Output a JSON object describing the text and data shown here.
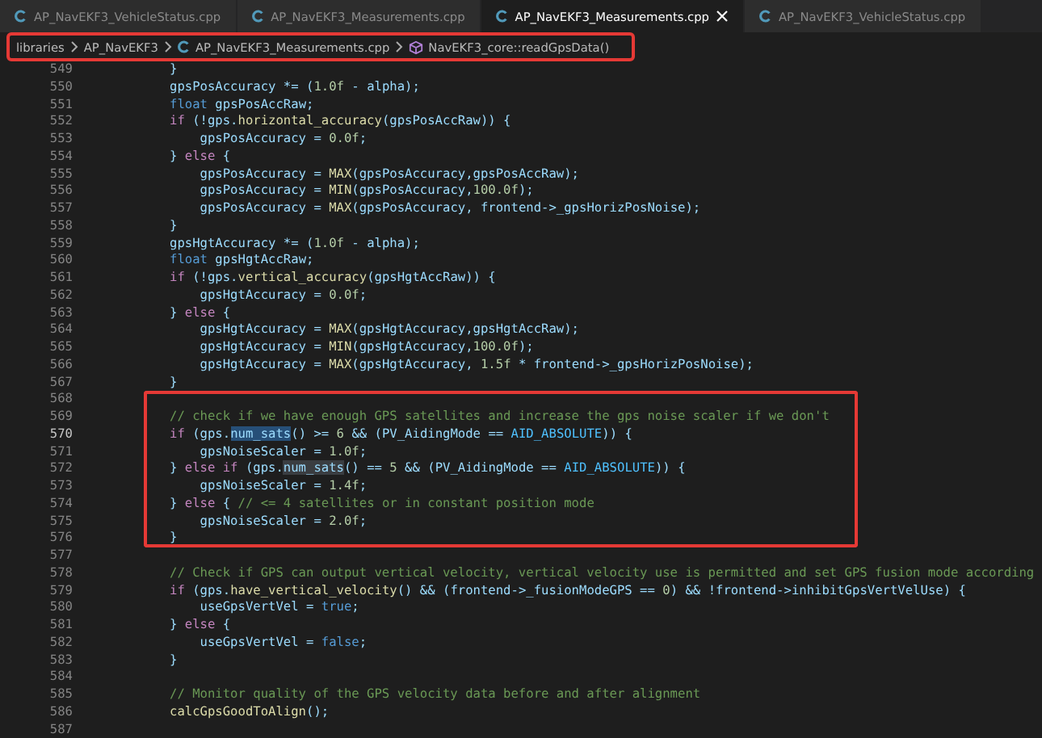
{
  "tabs": [
    {
      "label": "AP_NavEKF3_VehicleStatus.cpp",
      "selected": false
    },
    {
      "label": "AP_NavEKF3_Measurements.cpp",
      "selected": false
    },
    {
      "label": "AP_NavEKF3_Measurements.cpp",
      "selected": true
    },
    {
      "label": "AP_NavEKF3_VehicleStatus.cpp",
      "selected": false
    }
  ],
  "breadcrumb": {
    "outlined": true,
    "items": [
      {
        "kind": "folder",
        "label": "libraries"
      },
      {
        "kind": "folder",
        "label": "AP_NavEKF3"
      },
      {
        "kind": "file",
        "label": "AP_NavEKF3_Measurements.cpp"
      },
      {
        "kind": "symbol",
        "label": "NavEKF3_core::readGpsData()"
      }
    ]
  },
  "lines": [
    {
      "number": "549",
      "current": false,
      "outlined": false,
      "tokens": [
        {
          "kind": "var",
          "text": "}"
        }
      ]
    },
    {
      "number": "550",
      "current": false,
      "outlined": false,
      "tokens": [
        {
          "kind": "var",
          "text": "gpsPosAccuracy *= ("
        },
        {
          "kind": "num",
          "text": "1.0f"
        },
        {
          "kind": "var",
          "text": " - alpha);"
        }
      ]
    },
    {
      "number": "551",
      "current": false,
      "outlined": false,
      "tokens": [
        {
          "kind": "type",
          "text": "float"
        },
        {
          "kind": "var",
          "text": " gpsPosAccRaw;"
        }
      ]
    },
    {
      "number": "552",
      "current": false,
      "outlined": false,
      "tokens": [
        {
          "kind": "kw",
          "text": "if"
        },
        {
          "kind": "var",
          "text": " (!gps."
        },
        {
          "kind": "fn",
          "text": "horizontal_accuracy"
        },
        {
          "kind": "var",
          "text": "(gpsPosAccRaw)) {"
        }
      ]
    },
    {
      "number": "553",
      "current": false,
      "outlined": false,
      "tokens": [
        {
          "kind": "var",
          "text": "    gpsPosAccuracy = "
        },
        {
          "kind": "num",
          "text": "0.0f"
        },
        {
          "kind": "var",
          "text": ";"
        }
      ]
    },
    {
      "number": "554",
      "current": false,
      "outlined": false,
      "tokens": [
        {
          "kind": "var",
          "text": "} "
        },
        {
          "kind": "kw",
          "text": "else"
        },
        {
          "kind": "var",
          "text": " {"
        }
      ]
    },
    {
      "number": "555",
      "current": false,
      "outlined": false,
      "tokens": [
        {
          "kind": "var",
          "text": "    gpsPosAccuracy = "
        },
        {
          "kind": "fn",
          "text": "MAX"
        },
        {
          "kind": "var",
          "text": "(gpsPosAccuracy,gpsPosAccRaw);"
        }
      ]
    },
    {
      "number": "556",
      "current": false,
      "outlined": false,
      "tokens": [
        {
          "kind": "var",
          "text": "    gpsPosAccuracy = "
        },
        {
          "kind": "fn",
          "text": "MIN"
        },
        {
          "kind": "var",
          "text": "(gpsPosAccuracy,"
        },
        {
          "kind": "num",
          "text": "100.0f"
        },
        {
          "kind": "var",
          "text": ");"
        }
      ]
    },
    {
      "number": "557",
      "current": false,
      "outlined": false,
      "tokens": [
        {
          "kind": "var",
          "text": "    gpsPosAccuracy = "
        },
        {
          "kind": "fn",
          "text": "MAX"
        },
        {
          "kind": "var",
          "text": "(gpsPosAccuracy, frontend->_gpsHorizPosNoise);"
        }
      ]
    },
    {
      "number": "558",
      "current": false,
      "outlined": false,
      "tokens": [
        {
          "kind": "var",
          "text": "}"
        }
      ]
    },
    {
      "number": "559",
      "current": false,
      "outlined": false,
      "tokens": [
        {
          "kind": "var",
          "text": "gpsHgtAccuracy *= ("
        },
        {
          "kind": "num",
          "text": "1.0f"
        },
        {
          "kind": "var",
          "text": " - alpha);"
        }
      ]
    },
    {
      "number": "560",
      "current": false,
      "outlined": false,
      "tokens": [
        {
          "kind": "type",
          "text": "float"
        },
        {
          "kind": "var",
          "text": " gpsHgtAccRaw;"
        }
      ]
    },
    {
      "number": "561",
      "current": false,
      "outlined": false,
      "tokens": [
        {
          "kind": "kw",
          "text": "if"
        },
        {
          "kind": "var",
          "text": " (!gps."
        },
        {
          "kind": "fn",
          "text": "vertical_accuracy"
        },
        {
          "kind": "var",
          "text": "(gpsHgtAccRaw)) {"
        }
      ]
    },
    {
      "number": "562",
      "current": false,
      "outlined": false,
      "tokens": [
        {
          "kind": "var",
          "text": "    gpsHgtAccuracy = "
        },
        {
          "kind": "num",
          "text": "0.0f"
        },
        {
          "kind": "var",
          "text": ";"
        }
      ]
    },
    {
      "number": "563",
      "current": false,
      "outlined": false,
      "tokens": [
        {
          "kind": "var",
          "text": "} "
        },
        {
          "kind": "kw",
          "text": "else"
        },
        {
          "kind": "var",
          "text": " {"
        }
      ]
    },
    {
      "number": "564",
      "current": false,
      "outlined": false,
      "tokens": [
        {
          "kind": "var",
          "text": "    gpsHgtAccuracy = "
        },
        {
          "kind": "fn",
          "text": "MAX"
        },
        {
          "kind": "var",
          "text": "(gpsHgtAccuracy,gpsHgtAccRaw);"
        }
      ]
    },
    {
      "number": "565",
      "current": false,
      "outlined": false,
      "tokens": [
        {
          "kind": "var",
          "text": "    gpsHgtAccuracy = "
        },
        {
          "kind": "fn",
          "text": "MIN"
        },
        {
          "kind": "var",
          "text": "(gpsHgtAccuracy,"
        },
        {
          "kind": "num",
          "text": "100.0f"
        },
        {
          "kind": "var",
          "text": ");"
        }
      ]
    },
    {
      "number": "566",
      "current": false,
      "outlined": false,
      "tokens": [
        {
          "kind": "var",
          "text": "    gpsHgtAccuracy = "
        },
        {
          "kind": "fn",
          "text": "MAX"
        },
        {
          "kind": "var",
          "text": "(gpsHgtAccuracy, "
        },
        {
          "kind": "num",
          "text": "1.5f"
        },
        {
          "kind": "var",
          "text": " * frontend->_gpsHorizPosNoise);"
        }
      ]
    },
    {
      "number": "567",
      "current": false,
      "outlined": false,
      "tokens": [
        {
          "kind": "var",
          "text": "}"
        }
      ]
    },
    {
      "number": "568",
      "current": false,
      "outlined": true
    },
    {
      "number": "569",
      "current": false,
      "outlined": true,
      "tokens": [
        {
          "kind": "comment",
          "text": "// check if we have enough GPS satellites and increase the gps noise scaler if we don't"
        }
      ]
    },
    {
      "number": "570",
      "current": true,
      "outlined": true,
      "tokens": [
        {
          "kind": "kw",
          "text": "if"
        },
        {
          "kind": "var",
          "text": " (gps."
        },
        {
          "kind": "selection",
          "text": "num_sats"
        },
        {
          "kind": "var",
          "text": "() >= "
        },
        {
          "kind": "num",
          "text": "6"
        },
        {
          "kind": "var",
          "text": " && (PV_AidingMode == "
        },
        {
          "kind": "const",
          "text": "AID_ABSOLUTE"
        },
        {
          "kind": "var",
          "text": ")) {"
        }
      ]
    },
    {
      "number": "571",
      "current": false,
      "outlined": true,
      "tokens": [
        {
          "kind": "var",
          "text": "    gpsNoiseScaler = "
        },
        {
          "kind": "num",
          "text": "1.0f"
        },
        {
          "kind": "var",
          "text": ";"
        }
      ]
    },
    {
      "number": "572",
      "current": false,
      "outlined": true,
      "tokens": [
        {
          "kind": "var",
          "text": "} "
        },
        {
          "kind": "kw",
          "text": "else if"
        },
        {
          "kind": "var",
          "text": " (gps."
        },
        {
          "kind": "match",
          "text": "num_sats"
        },
        {
          "kind": "var",
          "text": "() == "
        },
        {
          "kind": "num",
          "text": "5"
        },
        {
          "kind": "var",
          "text": " && (PV_AidingMode == "
        },
        {
          "kind": "const",
          "text": "AID_ABSOLUTE"
        },
        {
          "kind": "var",
          "text": ")) {"
        }
      ]
    },
    {
      "number": "573",
      "current": false,
      "outlined": true,
      "tokens": [
        {
          "kind": "var",
          "text": "    gpsNoiseScaler = "
        },
        {
          "kind": "num",
          "text": "1.4f"
        },
        {
          "kind": "var",
          "text": ";"
        }
      ]
    },
    {
      "number": "574",
      "current": false,
      "outlined": true,
      "tokens": [
        {
          "kind": "var",
          "text": "} "
        },
        {
          "kind": "kw",
          "text": "else"
        },
        {
          "kind": "var",
          "text": " { "
        },
        {
          "kind": "comment",
          "text": "// <= 4 satellites or in constant position mode"
        }
      ]
    },
    {
      "number": "575",
      "current": false,
      "outlined": true,
      "tokens": [
        {
          "kind": "var",
          "text": "    gpsNoiseScaler = "
        },
        {
          "kind": "num",
          "text": "2.0f"
        },
        {
          "kind": "var",
          "text": ";"
        }
      ]
    },
    {
      "number": "576",
      "current": false,
      "outlined": true,
      "tokens": [
        {
          "kind": "var",
          "text": "}"
        }
      ]
    },
    {
      "number": "577",
      "current": false,
      "outlined": false
    },
    {
      "number": "578",
      "current": false,
      "outlined": false,
      "tokens": [
        {
          "kind": "comment",
          "text": "// Check if GPS can output vertical velocity, vertical velocity use is permitted and set GPS fusion mode according"
        }
      ]
    },
    {
      "number": "579",
      "current": false,
      "outlined": false,
      "tokens": [
        {
          "kind": "kw",
          "text": "if"
        },
        {
          "kind": "var",
          "text": " (gps."
        },
        {
          "kind": "fn",
          "text": "have_vertical_velocity"
        },
        {
          "kind": "var",
          "text": "() && (frontend->_fusionModeGPS == "
        },
        {
          "kind": "num",
          "text": "0"
        },
        {
          "kind": "var",
          "text": ") && !frontend->inhibitGpsVertVelUse) {"
        }
      ]
    },
    {
      "number": "580",
      "current": false,
      "outlined": false,
      "tokens": [
        {
          "kind": "var",
          "text": "    useGpsVertVel = "
        },
        {
          "kind": "type",
          "text": "true"
        },
        {
          "kind": "var",
          "text": ";"
        }
      ]
    },
    {
      "number": "581",
      "current": false,
      "outlined": false,
      "tokens": [
        {
          "kind": "var",
          "text": "} "
        },
        {
          "kind": "kw",
          "text": "else"
        },
        {
          "kind": "var",
          "text": " {"
        }
      ]
    },
    {
      "number": "582",
      "current": false,
      "outlined": false,
      "tokens": [
        {
          "kind": "var",
          "text": "    useGpsVertVel = "
        },
        {
          "kind": "type",
          "text": "false"
        },
        {
          "kind": "var",
          "text": ";"
        }
      ]
    },
    {
      "number": "583",
      "current": false,
      "outlined": false,
      "tokens": [
        {
          "kind": "var",
          "text": "}"
        }
      ]
    },
    {
      "number": "584",
      "current": false,
      "outlined": false
    },
    {
      "number": "585",
      "current": false,
      "outlined": false,
      "tokens": [
        {
          "kind": "comment",
          "text": "// Monitor quality of the GPS velocity data before and after alignment"
        }
      ]
    },
    {
      "number": "586",
      "current": false,
      "outlined": false,
      "tokens": [
        {
          "kind": "fn",
          "text": "calcGpsGoodToAlign"
        },
        {
          "kind": "var",
          "text": "();"
        }
      ]
    },
    {
      "number": "587",
      "current": false,
      "outlined": false
    }
  ]
}
